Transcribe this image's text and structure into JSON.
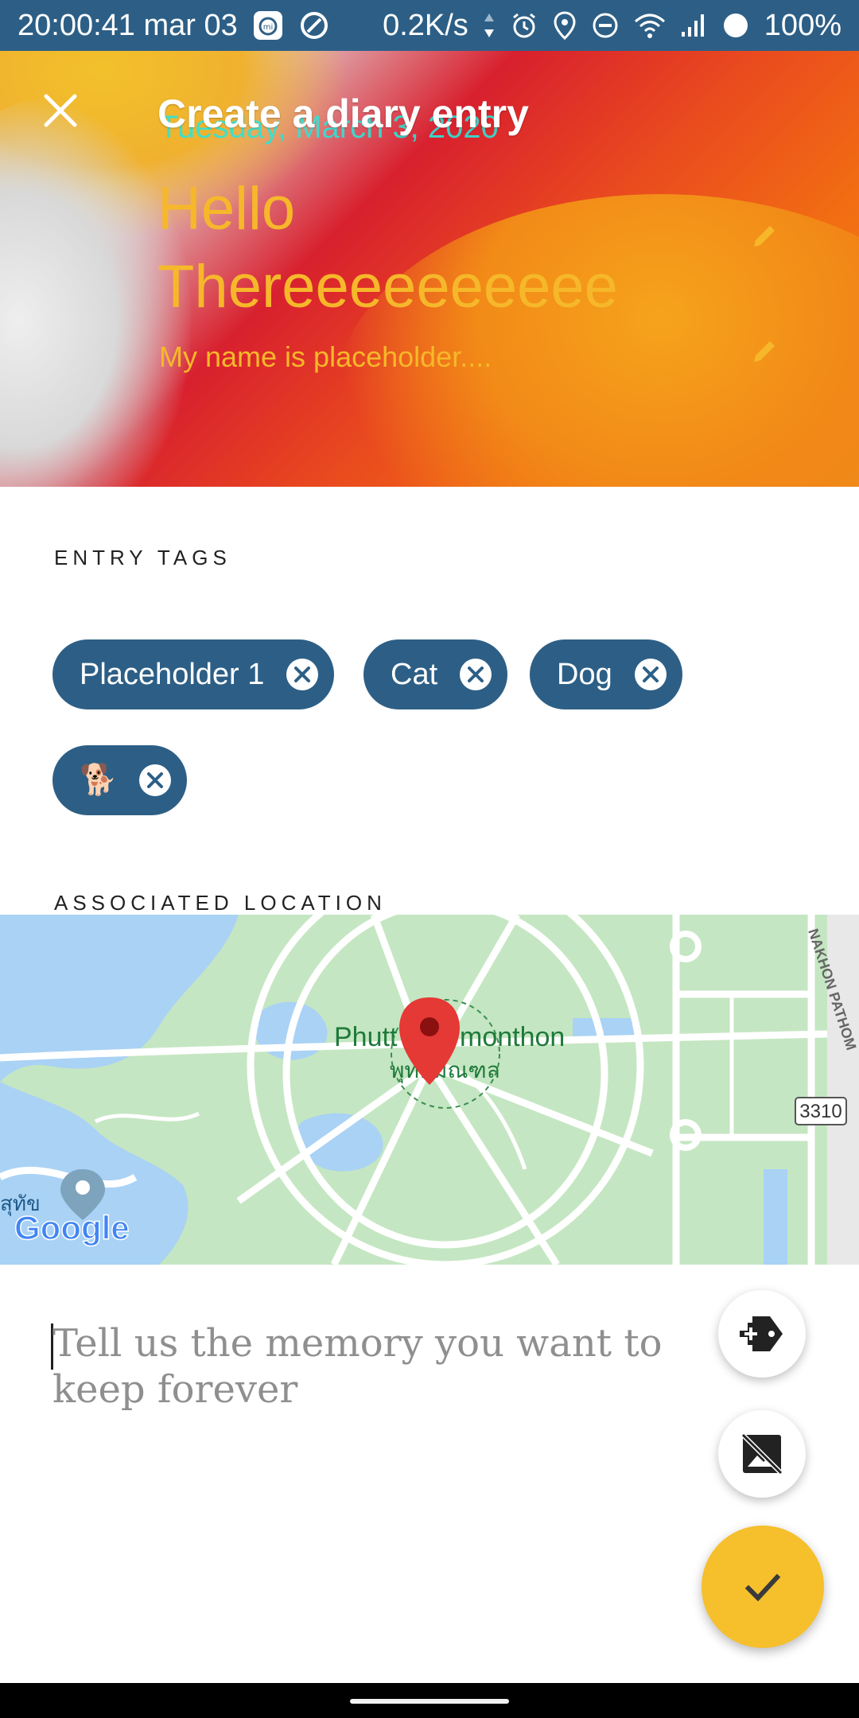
{
  "status_bar": {
    "time_date": "20:00:41 mar 03",
    "net_speed": "0.2K/s",
    "battery": "100%"
  },
  "header": {
    "title": "Create a diary entry",
    "date": "Tuesday, March 3, 2020",
    "entry_title": "Hello Thereeeeeeeeee",
    "entry_subtitle": "My name is placeholder...."
  },
  "tags_section": {
    "label": "ENTRY TAGS",
    "tags": [
      "Placeholder 1",
      "Cat",
      "Dog",
      "🐕"
    ]
  },
  "location_section": {
    "label": "ASSOCIATED LOCATION",
    "map": {
      "place_name_en_fragment_left": "Phutt",
      "place_name_en_fragment_right": "monthon",
      "place_name_th": "พุทธมณฑล",
      "road_label": "NAKHON PATHOM",
      "route_number": "3310",
      "left_thai_fragment": "สุทัข",
      "attribution": "Google"
    }
  },
  "memory_input": {
    "placeholder": "Tell us the memory you want to keep forever"
  },
  "colors": {
    "chip": "#2d5f86",
    "accent": "#f6bf2c",
    "status_bar": "#2d5f86",
    "header_text_yellow": "#f6b82a",
    "date_cyan": "#2fe3d7"
  },
  "icons": {
    "close": "close-icon",
    "edit": "pencil-icon",
    "chip_remove": "cancel-circle-icon",
    "add_tag": "tag-plus-icon",
    "no_image": "image-off-icon",
    "confirm": "check-icon",
    "map_pin": "map-pin-icon"
  }
}
